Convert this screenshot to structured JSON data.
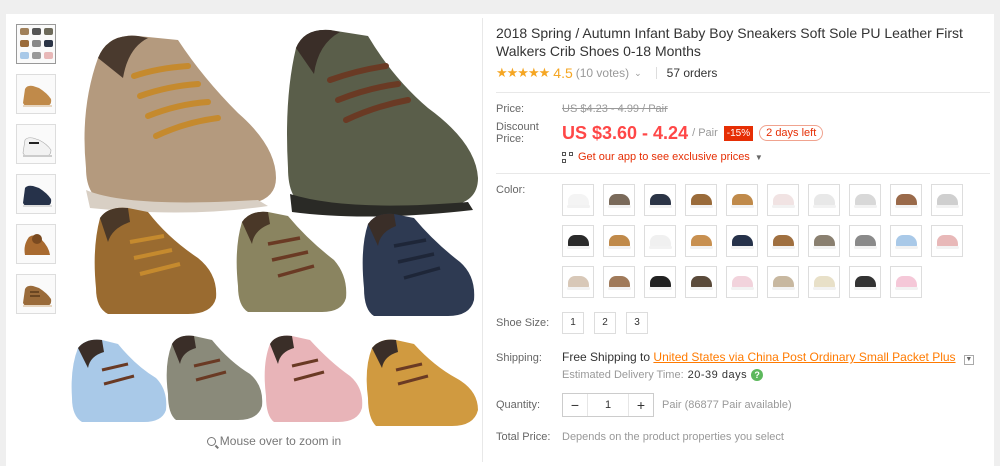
{
  "product": {
    "title": "2018 Spring / Autumn Infant Baby Boy Sneakers Soft Sole PU Leather First Walkers Crib Shoes 0-18 Months",
    "stars": "★★★★★",
    "rating": "4.5",
    "votes": "(10 votes)",
    "orders": "57 orders"
  },
  "pricing": {
    "price_label": "Price:",
    "original_price": "US $4.23 - 4.99 / Pair",
    "discount_label": "Discount Price:",
    "discount_price": "US $3.60 - 4.24",
    "unit": "/ Pair",
    "percent_off": "-15%",
    "days_left": "2 days left",
    "app_promo": "Get our app to see exclusive prices"
  },
  "gallery": {
    "zoom_hint": "Mouse over to zoom in",
    "thumbnails": [
      "multi",
      "tan",
      "white-black",
      "navy",
      "brown",
      "brown-2"
    ]
  },
  "color": {
    "label": "Color:",
    "swatches": [
      "#f4f4f4",
      "#7a6a5a",
      "#2b3446",
      "#9a6b3a",
      "#c08a4a",
      "#f1e3e3",
      "#e8e8e8",
      "#d8d8d8",
      "#9a6a4a",
      "#cfcfcf",
      "#2a2a2a",
      "#c08a4a",
      "#f0f0f0",
      "#c89050",
      "#26324a",
      "#a07040",
      "#8a8070",
      "#8a8a8a",
      "#a9c9e8",
      "#e8b8b8",
      "#d8c8b8",
      "#a07a5a",
      "#222222",
      "#5a4a3a",
      "#f2d3dc",
      "#c8b8a0",
      "#e8e0c8",
      "#333333",
      "#f5c8d8"
    ]
  },
  "size": {
    "label": "Shoe Size:",
    "options": [
      "1",
      "2",
      "3"
    ]
  },
  "shipping": {
    "label": "Shipping:",
    "free_text": "Free Shipping to",
    "destination": "United States via China Post Ordinary Small Packet Plus",
    "eta_label": "Estimated Delivery Time:",
    "eta_days": "20-39 days"
  },
  "quantity": {
    "label": "Quantity:",
    "value": "1",
    "availability": "Pair (86877 Pair available)"
  },
  "total": {
    "label": "Total Price:",
    "text": "Depends on the product properties you select"
  }
}
